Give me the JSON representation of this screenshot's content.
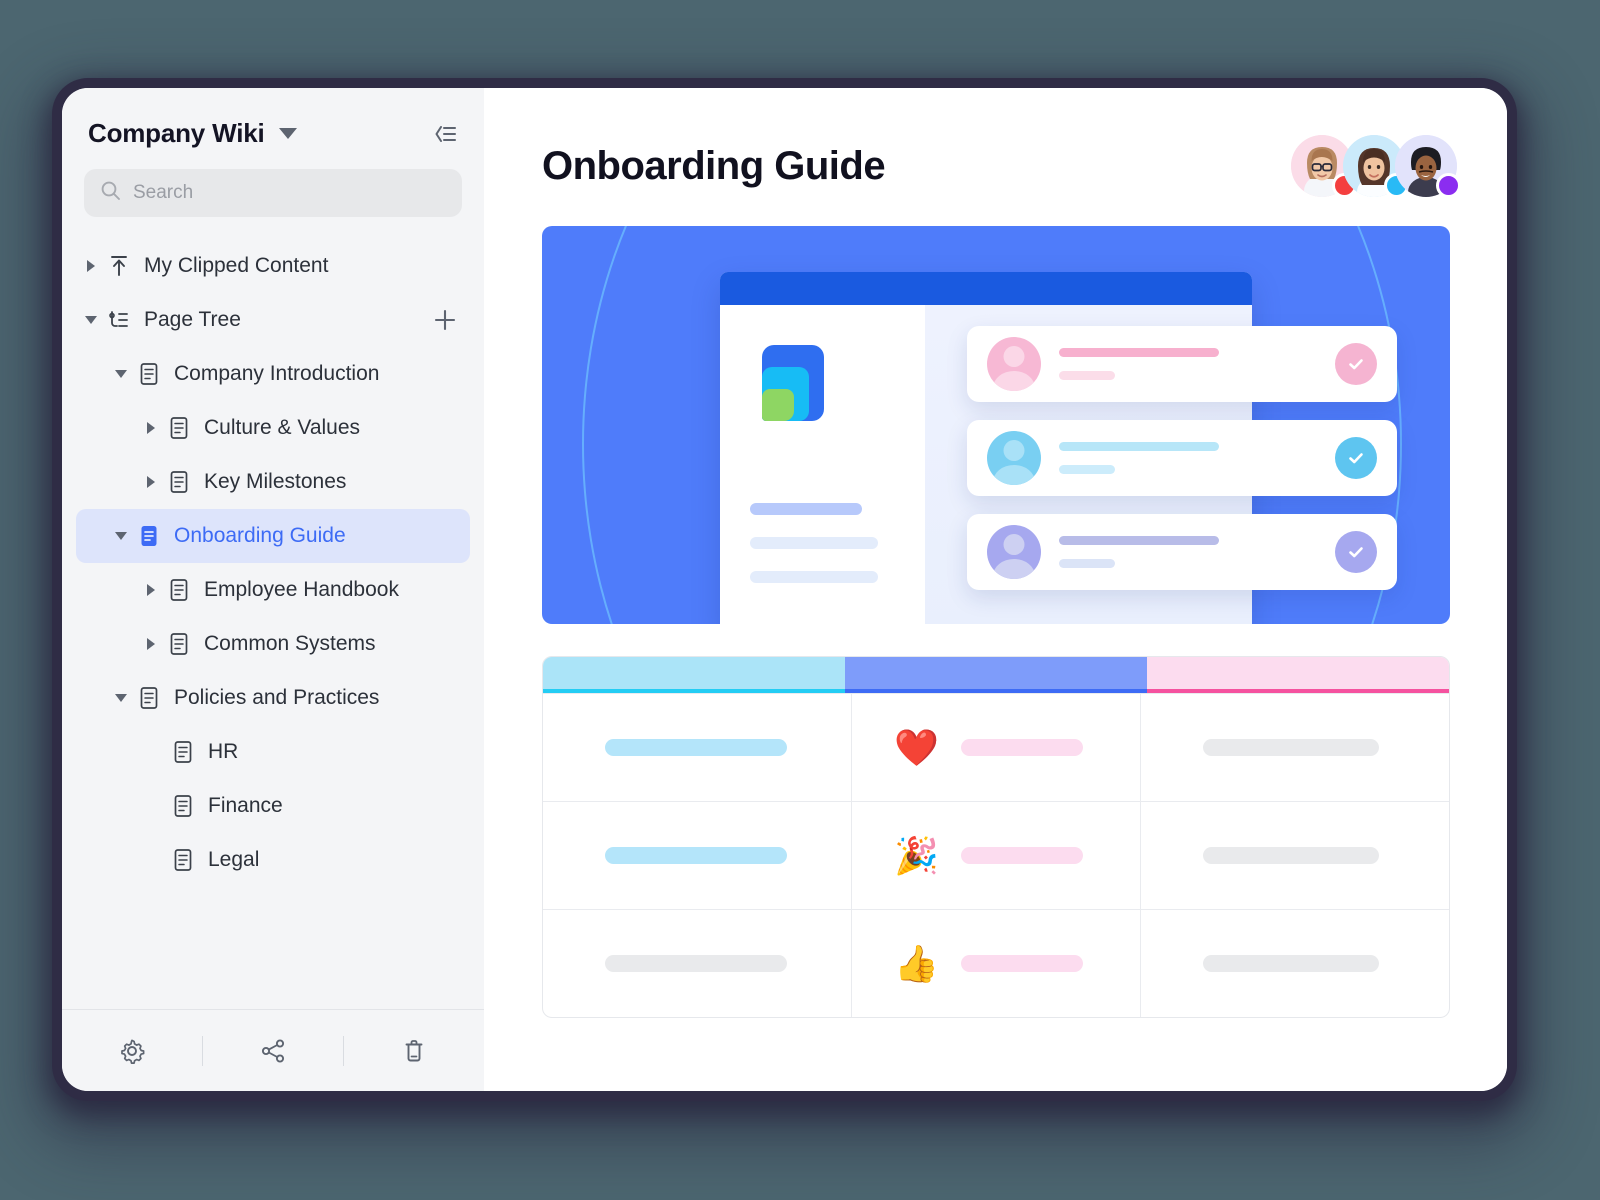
{
  "window": {
    "background_color": "#4c6670",
    "shadow_color": "#2f2c45"
  },
  "sidebar": {
    "title": "Company Wiki",
    "dropdown_icon": "chevron-down-icon",
    "collapse_icon": "collapse-panel-icon",
    "search": {
      "placeholder": "Search",
      "icon": "search-icon"
    },
    "add_icon": "plus-icon",
    "items": [
      {
        "label": "My Clipped Content",
        "icon": "clip-upload-icon",
        "twisty": "right",
        "depth": 0,
        "selected": false
      },
      {
        "label": "Page Tree",
        "icon": "page-tree-icon",
        "twisty": "down",
        "depth": 0,
        "selected": false,
        "action": "plus-icon"
      },
      {
        "label": "Company Introduction",
        "icon": "document-icon",
        "twisty": "down",
        "depth": 1,
        "selected": false
      },
      {
        "label": "Culture & Values",
        "icon": "document-icon",
        "twisty": "right",
        "depth": 2,
        "selected": false
      },
      {
        "label": "Key Milestones",
        "icon": "document-icon",
        "twisty": "right",
        "depth": 2,
        "selected": false
      },
      {
        "label": "Onboarding Guide",
        "icon": "document-icon-filled",
        "twisty": "down",
        "depth": 1,
        "selected": true
      },
      {
        "label": "Employee Handbook",
        "icon": "document-icon",
        "twisty": "right",
        "depth": 2,
        "selected": false
      },
      {
        "label": "Common Systems",
        "icon": "document-icon",
        "twisty": "right",
        "depth": 2,
        "selected": false
      },
      {
        "label": "Policies and Practices",
        "icon": "document-icon",
        "twisty": "down",
        "depth": 1,
        "selected": false
      },
      {
        "label": "HR",
        "icon": "document-icon",
        "twisty": "none",
        "depth": 2,
        "selected": false
      },
      {
        "label": "Finance",
        "icon": "document-icon",
        "twisty": "none",
        "depth": 2,
        "selected": false
      },
      {
        "label": "Legal",
        "icon": "document-icon",
        "twisty": "none",
        "depth": 2,
        "selected": false
      }
    ],
    "footer_icons": [
      "settings-gear-icon",
      "share-icon",
      "trash-icon"
    ],
    "selected_color": "#3d6bf5",
    "selected_row_bg": "#dde4fb"
  },
  "main": {
    "page_title": "Onboarding Guide",
    "avatars": [
      {
        "name": "avatar-1",
        "bg": "#fbdce8",
        "status_color": "#f43f3f"
      },
      {
        "name": "avatar-2",
        "bg": "#cbeafb",
        "status_color": "#29baf5"
      },
      {
        "name": "avatar-3",
        "bg": "#e2e3fb",
        "status_color": "#8b2df0"
      }
    ],
    "hero": {
      "background_color": "#4f7cfa",
      "browser_bar_color": "#1a5ae0",
      "logo_colors": [
        "#2f6ef0",
        "#17bcf5",
        "#8ed663"
      ],
      "left_bars": [
        "#b7c9fb",
        "#e3ecfb",
        "#e3ecfb"
      ],
      "cards": [
        {
          "avatar_color": "#f7b8d4",
          "line_color": "#f7b0ce",
          "line2_color": "#fbdde9",
          "check_bg": "#f5b4d1",
          "check_icon": "check-icon"
        },
        {
          "avatar_color": "#79cff2",
          "line_color": "#b7e6f8",
          "line2_color": "#ccecfb",
          "check_bg": "#5ec5f0",
          "check_icon": "check-icon"
        },
        {
          "avatar_color": "#a6a8ef",
          "line_color": "#b8bce8",
          "line2_color": "#dbe4f7",
          "check_bg": "#a6a8ef",
          "check_icon": "check-icon"
        }
      ]
    },
    "table": {
      "header_colors": [
        "#abe4f8",
        "#7e9cfa",
        "#fcdcef"
      ],
      "header_accent_colors": [
        "#24cdf4",
        "#3d6bf5",
        "#f5529f"
      ],
      "rows": [
        {
          "col1_pill": "#b4e5fa",
          "emoji": "❤️",
          "emoji_name": "heart-emoji",
          "col2_pill": "#fcdcef",
          "col3_pill": "#e9eaec"
        },
        {
          "col1_pill": "#b4e5fa",
          "emoji": "🎉",
          "emoji_name": "party-popper-emoji",
          "col2_pill": "#fcdcef",
          "col3_pill": "#e9eaec"
        },
        {
          "col1_pill": "#e9eaec",
          "emoji": "👍",
          "emoji_name": "thumbs-up-emoji",
          "col2_pill": "#fcdcef",
          "col3_pill": "#e9eaec"
        }
      ]
    }
  }
}
